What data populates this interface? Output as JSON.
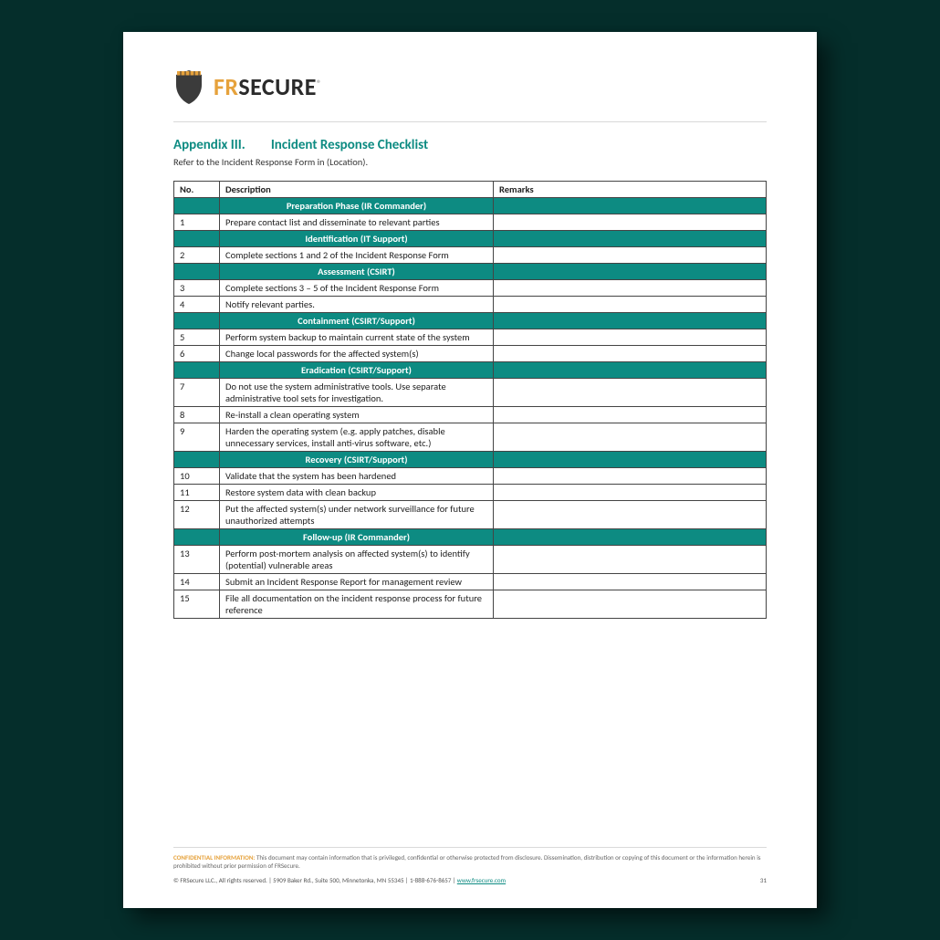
{
  "brand": {
    "part1": "FR",
    "part2": "SECURE",
    "reg": "®"
  },
  "title": {
    "appendix": "Appendix III.",
    "name": "Incident Response Checklist"
  },
  "subtitle": "Refer to the Incident Response Form in (Location).",
  "columns": {
    "no": "No.",
    "desc": "Description",
    "remarks": "Remarks"
  },
  "rows": [
    {
      "type": "section",
      "label": "Preparation Phase (IR Commander)"
    },
    {
      "type": "item",
      "no": "1",
      "desc": "Prepare contact list and disseminate to relevant parties",
      "remarks": ""
    },
    {
      "type": "section",
      "label": "Identification (IT Support)"
    },
    {
      "type": "item",
      "no": "2",
      "desc": "Complete sections 1 and 2 of the Incident Response Form",
      "remarks": ""
    },
    {
      "type": "section",
      "label": "Assessment (CSIRT)"
    },
    {
      "type": "item",
      "no": "3",
      "desc": "Complete sections 3 – 5 of the Incident Response Form",
      "remarks": ""
    },
    {
      "type": "item",
      "no": "4",
      "desc": "Notify relevant parties.",
      "remarks": ""
    },
    {
      "type": "section",
      "label": "Containment (CSIRT/Support)"
    },
    {
      "type": "item",
      "no": "5",
      "desc": "Perform system backup to maintain current state of the system",
      "remarks": ""
    },
    {
      "type": "item",
      "no": "6",
      "desc": "Change local passwords for the affected system(s)",
      "remarks": ""
    },
    {
      "type": "section",
      "label": "Eradication (CSIRT/Support)"
    },
    {
      "type": "item",
      "no": "7",
      "desc": "Do not use the system administrative tools. Use separate administrative tool sets for investigation.",
      "remarks": ""
    },
    {
      "type": "item",
      "no": "8",
      "desc": "Re-install a clean operating system",
      "remarks": ""
    },
    {
      "type": "item",
      "no": "9",
      "desc": "Harden the operating system (e.g. apply patches, disable unnecessary services, install anti-virus software, etc.)",
      "remarks": ""
    },
    {
      "type": "section",
      "label": "Recovery (CSIRT/Support)"
    },
    {
      "type": "item",
      "no": "10",
      "desc": "Validate that the system has been hardened",
      "remarks": ""
    },
    {
      "type": "item",
      "no": "11",
      "desc": "Restore system data with clean backup",
      "remarks": ""
    },
    {
      "type": "item",
      "no": "12",
      "desc": "Put the affected system(s) under network surveillance for future unauthorized attempts",
      "remarks": ""
    },
    {
      "type": "section",
      "label": "Follow-up (IR Commander)"
    },
    {
      "type": "item",
      "no": "13",
      "desc": "Perform post-mortem analysis on affected system(s) to identify (potential) vulnerable areas",
      "remarks": ""
    },
    {
      "type": "item",
      "no": "14",
      "desc": "Submit an Incident Response Report for management review",
      "remarks": ""
    },
    {
      "type": "item",
      "no": "15",
      "desc": "File all documentation on the incident response process for future reference",
      "remarks": ""
    }
  ],
  "footer": {
    "conf_label": "CONFIDENTIAL INFORMATION:",
    "conf_text": " This document may contain information that is privileged, confidential or otherwise protected from disclosure. Dissemination, distribution or copying of this document or the information herein is prohibited without prior permission of FRSecure.",
    "copyright": "© FRSecure LLC., All rights reserved. | 5909 Baker Rd., Suite 500, Minnetonka, MN 55345 | 1-888-676-8657 | ",
    "link": "www.frsecure.com",
    "page_number": "31"
  }
}
